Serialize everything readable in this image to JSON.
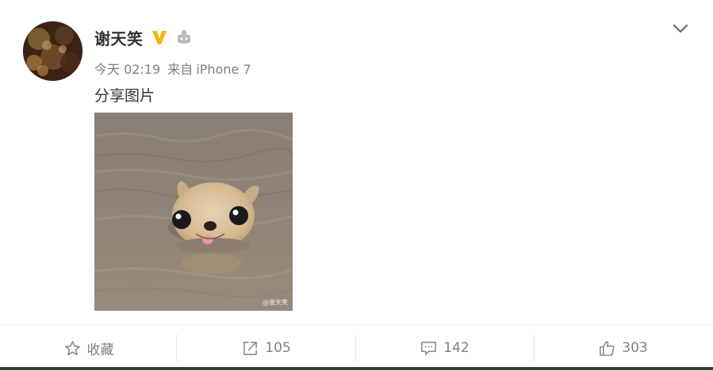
{
  "post": {
    "user_name": "谢天笑",
    "time": "今天 02:19",
    "source_prefix": "来自",
    "source": "iPhone 7",
    "text": "分享图片",
    "image_watermark": "@谢天笑"
  },
  "icons": {
    "verified": "verified-v-icon",
    "vip": "member-crown-icon",
    "menu": "chevron-down-icon",
    "favorite": "star-outline-icon",
    "repost": "share-arrow-icon",
    "comment": "comment-bubble-icon",
    "like": "thumbs-up-icon"
  },
  "actions": {
    "favorite_label": "收藏",
    "repost_count": "105",
    "comment_count": "142",
    "like_count": "303"
  },
  "colors": {
    "verified": "#f7b500",
    "text": "#333333",
    "muted": "#808080"
  }
}
